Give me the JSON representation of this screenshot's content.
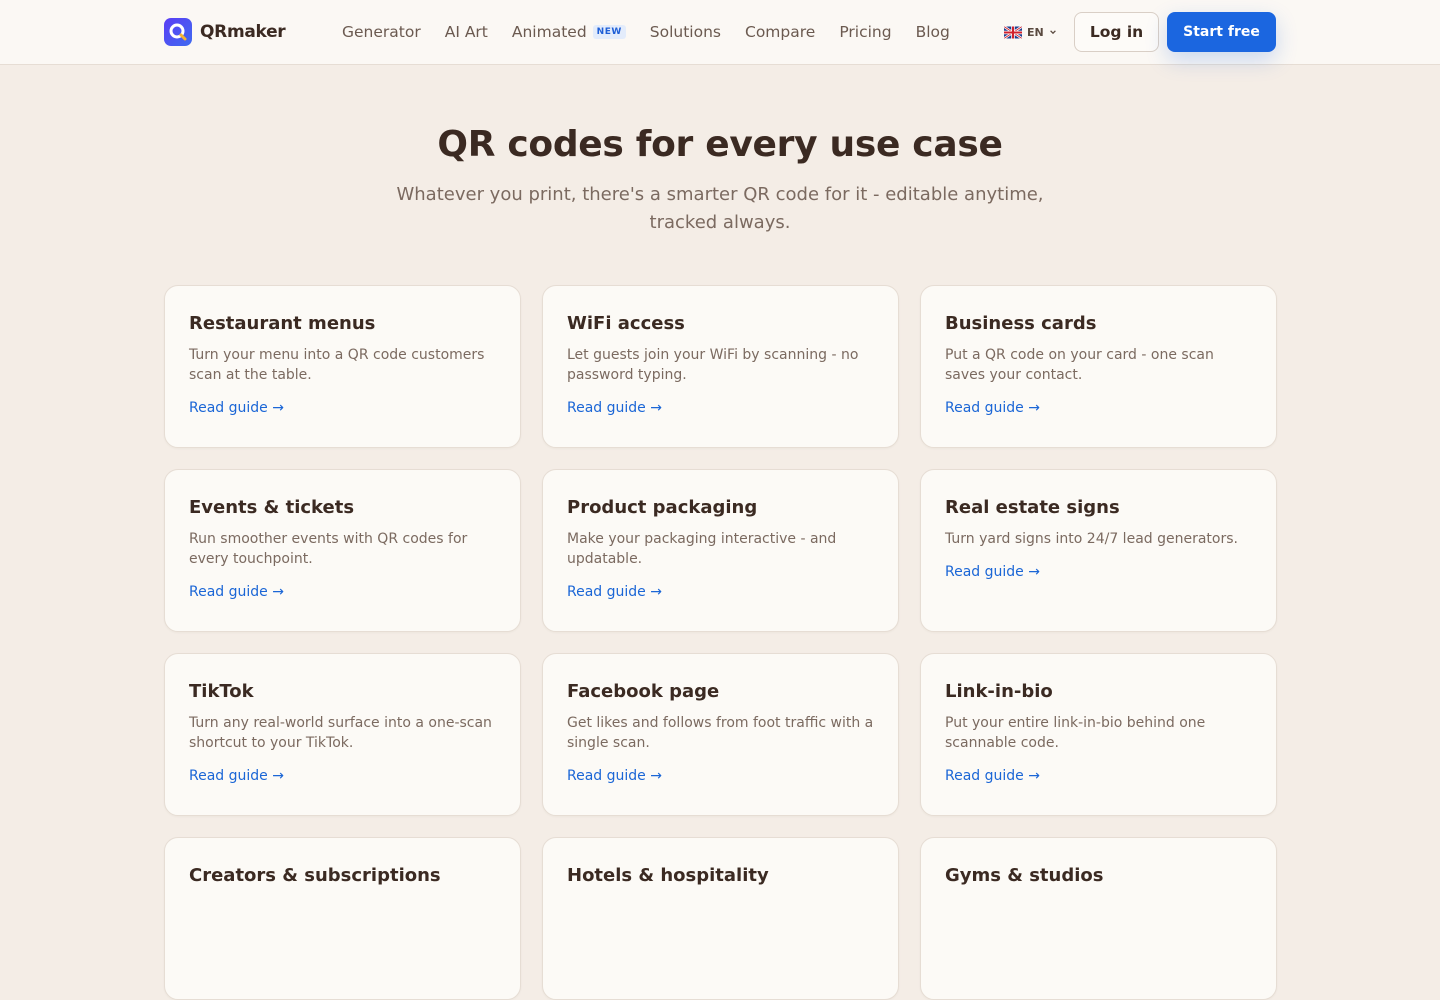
{
  "brand": {
    "name": "QRmaker",
    "accent": "#1b66e0"
  },
  "nav": {
    "items": [
      {
        "label": "Generator"
      },
      {
        "label": "AI Art"
      },
      {
        "label": "Animated",
        "badge": "NEW"
      },
      {
        "label": "Solutions"
      },
      {
        "label": "Compare"
      },
      {
        "label": "Pricing"
      },
      {
        "label": "Blog"
      }
    ],
    "language": "EN",
    "login_label": "Log in",
    "start_label": "Start free"
  },
  "hero": {
    "title": "QR codes for every use case",
    "subtitle": "Whatever you print, there's a smarter QR code for it - editable anytime, tracked always."
  },
  "cards": [
    {
      "title": "Restaurant menus",
      "desc": "Turn your menu into a QR code customers scan at the table.",
      "link": "Read guide →"
    },
    {
      "title": "WiFi access",
      "desc": "Let guests join your WiFi by scanning - no password typing.",
      "link": "Read guide →"
    },
    {
      "title": "Business cards",
      "desc": "Put a QR code on your card - one scan saves your contact.",
      "link": "Read guide →"
    },
    {
      "title": "Events & tickets",
      "desc": "Run smoother events with QR codes for every touchpoint.",
      "link": "Read guide →"
    },
    {
      "title": "Product packaging",
      "desc": "Make your packaging interactive - and updatable.",
      "link": "Read guide →"
    },
    {
      "title": "Real estate signs",
      "desc": "Turn yard signs into 24/7 lead generators.",
      "link": "Read guide →"
    },
    {
      "title": "TikTok",
      "desc": "Turn any real-world surface into a one-scan shortcut to your TikTok.",
      "link": "Read guide →"
    },
    {
      "title": "Facebook page",
      "desc": "Get likes and follows from foot traffic with a single scan.",
      "link": "Read guide →"
    },
    {
      "title": "Link-in-bio",
      "desc": "Put your entire link-in-bio behind one scannable code.",
      "link": "Read guide →"
    },
    {
      "title": "Creators & subscriptions",
      "desc": "",
      "link": ""
    },
    {
      "title": "Hotels & hospitality",
      "desc": "",
      "link": ""
    },
    {
      "title": "Gyms & studios",
      "desc": "",
      "link": ""
    }
  ]
}
